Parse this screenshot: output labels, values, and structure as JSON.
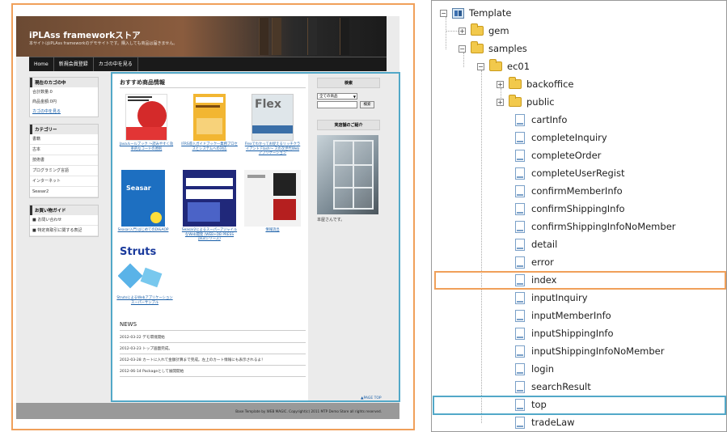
{
  "site": {
    "title": "iPLAss frameworkストア",
    "subtitle": "本サイトはiPLAss frameworkのデモサイトです。購入しても商品は届きません。",
    "nav": [
      "Home",
      "新規会員登録",
      "カゴの中を見る"
    ],
    "cart": {
      "heading": "現在のカゴの中",
      "count": "合計数量:0",
      "amount": "商品金額:0円",
      "link": "カゴの中を見る"
    },
    "category": {
      "heading": "カテゴリー",
      "items": [
        "書籍",
        "古本",
        "技術書",
        "プログラミング言語",
        "インターネット",
        "Seasar2"
      ]
    },
    "guide": {
      "heading": "お買い物ガイド",
      "items": [
        "■ お問い合わせ",
        "■ 特定商取引に関する表記"
      ]
    },
    "main_title": "おすすめ商品情報",
    "books": [
      {
        "caption": "Javaルールブック ～読みやすく効率的なコードの原則",
        "cover_text": "Java ルールブック"
      },
      {
        "caption": "IFRS導入ガイドブック―業務プロセスとシステムへの対応",
        "cover_text": "IFRS 導入ガイドブック"
      },
      {
        "caption": "Flexでわかってお捉えるリッチクライアント Flash～ スの次世代Webアプリケーション",
        "cover_text": "Flex"
      },
      {
        "caption": "Seasar入門 はじめてのDI&AOP",
        "cover_text": "Seasar"
      },
      {
        "caption": "Seasar2によるスーパーアジャイルなWeb開発 (WEB+DB PRESS plusシリーズ)",
        "cover_text": "スーパーアジャイルなWeb開発"
      },
      {
        "caption": "情報流出",
        "cover_text": "情報 流出"
      },
      {
        "caption": "StrutsによるWebアプリケーションスーパーサンプル",
        "cover_text": "Struts"
      }
    ],
    "news_heading": "NEWS",
    "news": [
      "2012-03-22 デモ環境開始",
      "2012-03-23 トップ画面完成。",
      "2012-03-28 カートに入れて金額計算まで完成。左上のカート情報にも表示されるよ！",
      "2012-06-14 Packageとして展開開始"
    ],
    "search": {
      "heading": "検索",
      "select": "全ての商品",
      "button": "検索"
    },
    "shop": {
      "heading": "実店舗のご紹介",
      "caption": "本屋さんです。"
    },
    "pagetop": "▲PAGE TOP",
    "footer": "Base Template by WEB MAGIC. Copyright(c) 2011 MTP Demo Store all rights reserved."
  },
  "tree": {
    "root": "Template",
    "gem": "gem",
    "samples": "samples",
    "ec01": "ec01",
    "folders": [
      "backoffice",
      "public"
    ],
    "files": [
      "cartInfo",
      "completeInquiry",
      "completeOrder",
      "completeUserRegist",
      "confirmMemberInfo",
      "confirmShippingInfo",
      "confirmShippingInfoNoMember",
      "detail",
      "error",
      "index",
      "inputInquiry",
      "inputMemberInfo",
      "inputShippingInfo",
      "inputShippingInfoNoMember",
      "login",
      "searchResult",
      "top",
      "tradeLaw"
    ]
  }
}
